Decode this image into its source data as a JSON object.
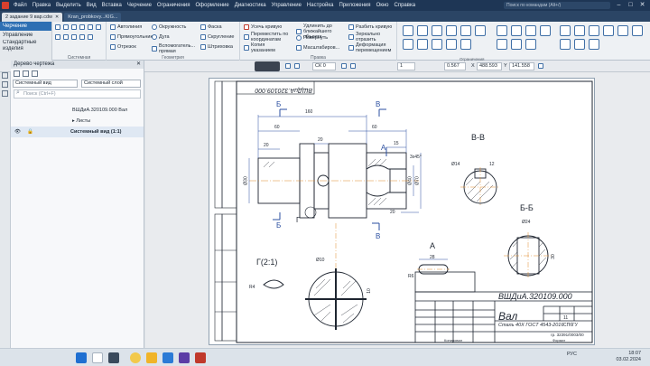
{
  "menubar": {
    "items": [
      "Файл",
      "Правка",
      "Выделить",
      "Вид",
      "Вставка",
      "Черчение",
      "Ограничения",
      "Оформление",
      "Диагностика",
      "Управление",
      "Настройка",
      "Приложения",
      "Окно",
      "Справка"
    ],
    "search_placeholder": "Поиск по командам (Alt+/)"
  },
  "tabs": [
    {
      "label": "2 задание 9 вар.cdw",
      "active": true
    },
    {
      "label": "Kran_probkovy...KIG...",
      "active": false
    }
  ],
  "ribbon": {
    "left_panel": [
      "Черчение",
      "Управление",
      "Стандартные изделия"
    ],
    "group_labels": [
      "Системная",
      "Геометрия",
      "Правка"
    ],
    "geometry": {
      "col1": [
        "Автолиния",
        "Прямоугольник",
        "Отрезок"
      ],
      "col2": [
        "Окружность",
        "Дуга",
        "Вспомогатель... прямая"
      ],
      "col3": [
        "Фаска",
        "Скругление",
        "Штриховка"
      ]
    },
    "edit": {
      "col1": [
        "Усечь кривую",
        "Переместить по координатам",
        "Копия указанием"
      ],
      "col2": [
        "Удлинить до ближайшего объекта",
        "Повернуть",
        "Масштабиров..."
      ],
      "col3": [
        "Разбить кривую",
        "Зеркально отразить",
        "Деформация перемещением"
      ]
    }
  },
  "toolbar2": {
    "layer": "СК 0",
    "step": "1",
    "scale": "0.567",
    "x_label": "X",
    "x_value": "488.593",
    "y_label": "Y",
    "y_value": "141.558",
    "group_label": "Ограничения"
  },
  "tree": {
    "title": "Дерево чертежа",
    "view_select": "Системный вид",
    "layer_select": "Системный слой",
    "search_placeholder": "Поиск (Ctrl+F)",
    "rows": [
      "ВШДиА.320109.000 Вал",
      "Листы",
      "Системный вид (1:1)"
    ]
  },
  "drawing": {
    "doc_code": "ВШДиА.320109.000",
    "doc_code_rotated": "ВШДиА.320109.000",
    "title": "Вал",
    "material": "Сталь 40Х ГОСТ 4543-2016",
    "org": "СПбГУ",
    "group": "гр. 32391/0003/00",
    "sheet_count": "11",
    "format": "Формат",
    "copied": "Копировал",
    "section_bb": "Б-Б",
    "section_vv": "В-В",
    "view_a": "А",
    "detail_g": "Г(2:1)",
    "letters": {
      "b": "Б",
      "v": "В",
      "a": "А",
      "g": "Г"
    },
    "dims": {
      "d60a": "60",
      "d160": "160",
      "d60b": "60",
      "d20a": "20",
      "d20b": "20",
      "d20c": "20",
      "d15": "15",
      "d3x45": "3x45°",
      "d30": "Ø30",
      "d40": "Ø40",
      "d70": "Ø70",
      "d14": "Ø14",
      "d12": "12",
      "d24": "Ø24",
      "d30b": "30",
      "d28": "28",
      "r6": "R6",
      "r4": "R4",
      "d10": "Ø10",
      "d10b": "10"
    }
  },
  "taskbar": {
    "lang": "РУС",
    "time": "18:07",
    "date": "03.02.2024"
  },
  "colors": {
    "menubar": "#1e3655",
    "accent": "#2d6fb3",
    "drawing_line": "#1e2530",
    "axis": "#e08a2c",
    "dim_blue": "#2b4fa0"
  }
}
